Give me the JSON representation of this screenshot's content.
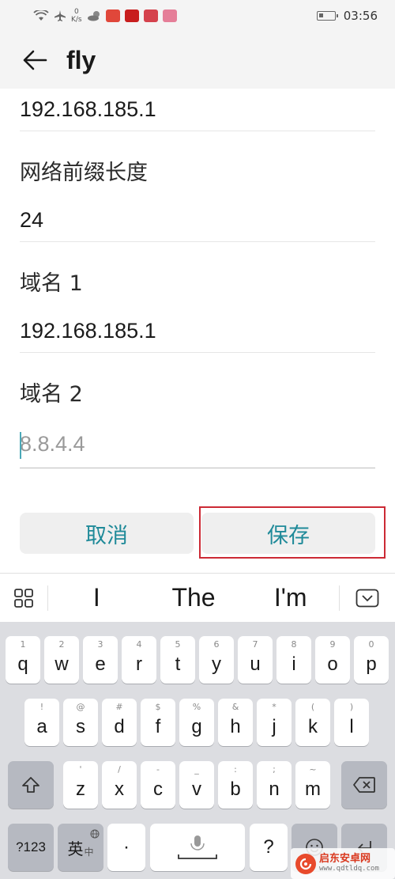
{
  "status_bar": {
    "net_speed_value": "0",
    "net_speed_unit": "K/s",
    "clock": "03:56"
  },
  "header": {
    "title": "fly"
  },
  "form": {
    "gateway_value": "192.168.185.1",
    "prefix_label": "网络前缀长度",
    "prefix_value": "24",
    "dns1_label": "域名 1",
    "dns1_value": "192.168.185.1",
    "dns2_label": "域名 2",
    "dns2_placeholder": "8.8.4.4"
  },
  "actions": {
    "cancel_label": "取消",
    "save_label": "保存"
  },
  "suggestions": [
    "I",
    "The",
    "I'm"
  ],
  "keyboard": {
    "row1": [
      {
        "key": "q",
        "hint": "1"
      },
      {
        "key": "w",
        "hint": "2"
      },
      {
        "key": "e",
        "hint": "3"
      },
      {
        "key": "r",
        "hint": "4"
      },
      {
        "key": "t",
        "hint": "5"
      },
      {
        "key": "y",
        "hint": "6"
      },
      {
        "key": "u",
        "hint": "7"
      },
      {
        "key": "i",
        "hint": "8"
      },
      {
        "key": "o",
        "hint": "9"
      },
      {
        "key": "p",
        "hint": "0"
      }
    ],
    "row2": [
      {
        "key": "a",
        "hint": "!"
      },
      {
        "key": "s",
        "hint": "@"
      },
      {
        "key": "d",
        "hint": "#"
      },
      {
        "key": "f",
        "hint": "$"
      },
      {
        "key": "g",
        "hint": "%"
      },
      {
        "key": "h",
        "hint": "&"
      },
      {
        "key": "j",
        "hint": "*"
      },
      {
        "key": "k",
        "hint": "("
      },
      {
        "key": "l",
        "hint": ")"
      }
    ],
    "row3": [
      {
        "key": "z",
        "hint": "'"
      },
      {
        "key": "x",
        "hint": "/"
      },
      {
        "key": "c",
        "hint": "-"
      },
      {
        "key": "v",
        "hint": "_"
      },
      {
        "key": "b",
        "hint": ":"
      },
      {
        "key": "n",
        "hint": ";"
      },
      {
        "key": "m",
        "hint": "~"
      }
    ],
    "symbols_label": "?123",
    "lang_label": "英",
    "lang_sub_label": "中",
    "dot_label": "·",
    "question_label": "?"
  },
  "watermark": {
    "main_text": "启东安卓网",
    "sub_text": "www.qdtldq.com"
  },
  "colors": {
    "accent": "#1f8a99",
    "highlight_frame": "#cc2a35",
    "keyboard_bg": "#dcdde1"
  }
}
